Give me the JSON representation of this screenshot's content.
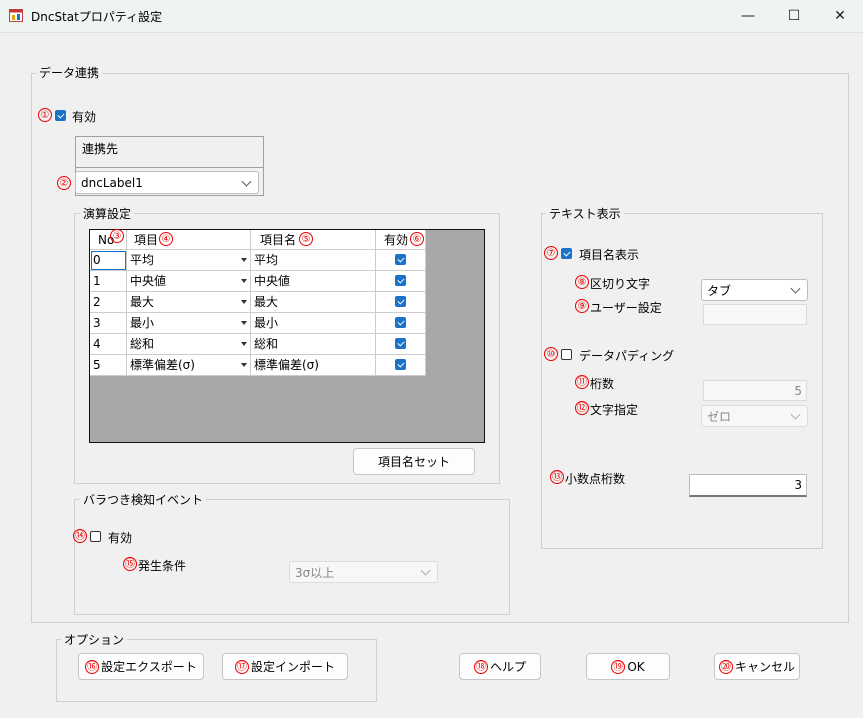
{
  "window": {
    "title": "DncStatプロパティ設定",
    "minimize": "—",
    "maximize": "☐",
    "close": "✕"
  },
  "data_link": {
    "group_label": "データ連携",
    "enabled_marker": "①",
    "enabled_label": "有効",
    "enabled_checked": true,
    "target_label": "連携先",
    "target_marker": "②",
    "target_value": "dncLabel1"
  },
  "calc": {
    "group_label": "演算設定",
    "headers": {
      "no": "No",
      "item": "項目",
      "item_name": "項目名",
      "valid": "有効"
    },
    "header_markers": {
      "no": "③",
      "item": "④",
      "item_name": "⑤",
      "valid": "⑥"
    },
    "rows": [
      {
        "no": "0",
        "item": "平均",
        "name": "平均",
        "valid": true
      },
      {
        "no": "1",
        "item": "中央値",
        "name": "中央値",
        "valid": true
      },
      {
        "no": "2",
        "item": "最大",
        "name": "最大",
        "valid": true
      },
      {
        "no": "3",
        "item": "最小",
        "name": "最小",
        "valid": true
      },
      {
        "no": "4",
        "item": "総和",
        "name": "総和",
        "valid": true
      },
      {
        "no": "5",
        "item": "標準偏差(σ)",
        "name": "標準偏差(σ)",
        "valid": true
      }
    ],
    "set_names_button": "項目名セット"
  },
  "text_display": {
    "group_label": "テキスト表示",
    "show_names_marker": "⑦",
    "show_names_label": "項目名表示",
    "show_names_checked": true,
    "delimiter_marker": "⑧",
    "delimiter_label": "区切り文字",
    "delimiter_value": "タブ",
    "user_setting_marker": "⑨",
    "user_setting_label": "ユーザー設定",
    "user_setting_value": "",
    "padding_marker": "⑩",
    "padding_label": "データパディング",
    "padding_checked": false,
    "digits_marker": "⑪",
    "digits_label": "桁数",
    "digits_value": "5",
    "char_marker": "⑫",
    "char_label": "文字指定",
    "char_value": "ゼロ",
    "decimal_marker": "⑬",
    "decimal_label": "小数点桁数",
    "decimal_value": "3"
  },
  "variation": {
    "group_label": "バラつき検知イベント",
    "enabled_marker": "⑭",
    "enabled_label": "有効",
    "enabled_checked": false,
    "condition_marker": "⑮",
    "condition_label": "発生条件",
    "condition_value": "3σ以上"
  },
  "options": {
    "group_label": "オプション",
    "export_marker": "⑯",
    "export_label": "設定エクスポート",
    "import_marker": "⑰",
    "import_label": "設定インポート"
  },
  "footer": {
    "help_marker": "⑱",
    "help_label": "ヘルプ",
    "ok_marker": "⑲",
    "ok_label": "OK",
    "cancel_marker": "⑳",
    "cancel_label": "キャンセル"
  },
  "colors": {
    "accent": "#1a73c9",
    "marker": "#e00000",
    "titlebar": "#eef4ef",
    "panel": "#f0f0f0",
    "grid_bg": "#a8a8a8"
  },
  "icons": {
    "app": "app-window-icon",
    "check": "checkmark-icon",
    "dropdown": "chevron-down-icon"
  }
}
